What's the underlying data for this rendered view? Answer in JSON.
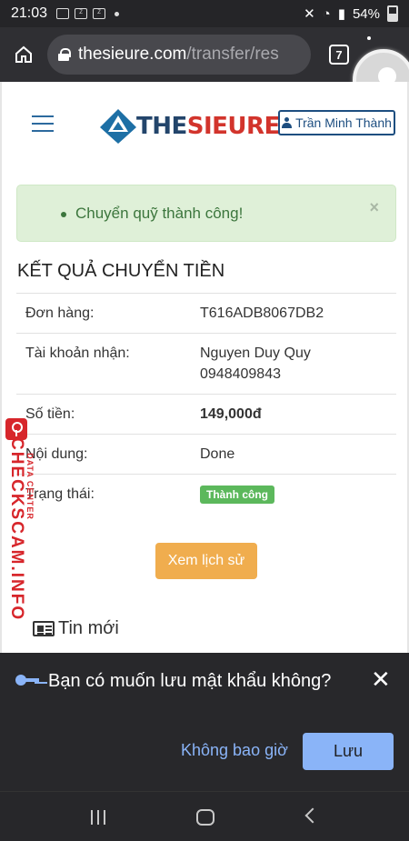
{
  "status_bar": {
    "time": "21:03",
    "notification_icons": [
      "gallery-icon",
      "zalo-icon",
      "zalo-icon"
    ],
    "battery": "54%"
  },
  "browser": {
    "url_host": "thesieure.com",
    "url_path": "/transfer/res",
    "tab_count": "7"
  },
  "site": {
    "logo_the": "THE",
    "logo_sieure": "SIEURE",
    "user_name": "Trần Minh Thành"
  },
  "alert": {
    "message": "Chuyển quỹ thành công!",
    "close": "×"
  },
  "result": {
    "title": "KẾT QUẢ CHUYỂN TIỀN",
    "rows": [
      {
        "label": "Đơn hàng:",
        "value": "T616ADB8067DB2"
      },
      {
        "label": "Tài khoản nhận:",
        "value": "Nguyen Duy Quy",
        "value2": "0948409843"
      },
      {
        "label": "Số tiền:",
        "value": "149,000đ"
      },
      {
        "label": "Nội dung:",
        "value": "Done"
      },
      {
        "label": "Trạng thái:",
        "value": "Thành công"
      }
    ],
    "history_button": "Xem lịch sử"
  },
  "news": {
    "title": "Tin mới"
  },
  "watermark": {
    "main": "CHECKSCAM.INFO",
    "sub": "DATA CENTER"
  },
  "save_password": {
    "question": "Bạn có muốn lưu mật khẩu không?",
    "never": "Không bao giờ",
    "save": "Lưu",
    "close": "✕"
  },
  "colors": {
    "alert_bg": "#dff0d8",
    "success_badge": "#5cb85c",
    "history_button": "#f0ad4e",
    "chrome_accent": "#8ab4f8"
  }
}
